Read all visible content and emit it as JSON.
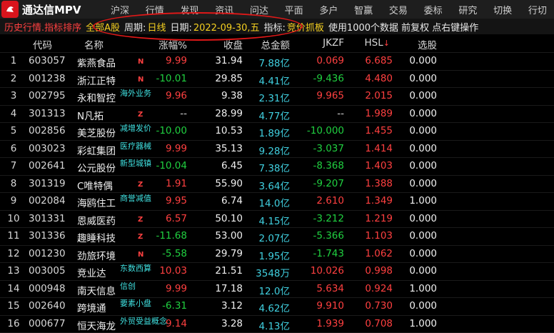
{
  "app": {
    "title": "通达信MPV"
  },
  "menu": [
    "沪深",
    "行情",
    "发现",
    "资讯",
    "问达",
    "平面",
    "多户",
    "智赢",
    "交易",
    "委标",
    "研究",
    "切换",
    "行切"
  ],
  "filter": {
    "history": "历史行情.指标排序",
    "market": "全部A股",
    "period_label": "周期:",
    "period_value": "日线",
    "date_label": "日期:",
    "date_value": "2022-09-30,五",
    "indicator_label": "指标:",
    "indicator_value": "竞价抓板",
    "note": "使用1000个数据 前复权 点右键操作"
  },
  "columns": [
    "代码",
    "名称",
    "涨幅%",
    "收盘",
    "总金额",
    "JKZF",
    "HSL",
    "选股"
  ],
  "colors": {
    "up": "#ff4040",
    "down": "#20d040",
    "accent": "#40d0e0",
    "tag": "#40e0e0"
  },
  "rows": [
    {
      "idx": "1",
      "code": "603057",
      "name": "紫燕食品",
      "mark": "N",
      "tag": "",
      "chg": "9.99",
      "close": "31.94",
      "amt": "7.88亿",
      "jk": "0.069",
      "hsl": "6.685",
      "sel": "0.000",
      "dir": "up",
      "jdir": "up"
    },
    {
      "idx": "2",
      "code": "001238",
      "name": "浙江正特",
      "mark": "N",
      "tag": "",
      "chg": "-10.01",
      "close": "29.85",
      "amt": "4.41亿",
      "jk": "-9.436",
      "hsl": "4.480",
      "sel": "0.000",
      "dir": "dn",
      "jdir": "dn"
    },
    {
      "idx": "3",
      "code": "002795",
      "name": "永和智控",
      "mark": "",
      "tag": "海外业务",
      "chg": "9.96",
      "close": "9.38",
      "amt": "2.31亿",
      "jk": "9.965",
      "hsl": "2.015",
      "sel": "0.000",
      "dir": "up",
      "jdir": "up"
    },
    {
      "idx": "4",
      "code": "301313",
      "name": "N凡拓",
      "mark": "Z",
      "tag": "",
      "chg": "--",
      "close": "28.99",
      "amt": "4.77亿",
      "jk": "--",
      "hsl": "1.989",
      "sel": "0.000",
      "dir": "flat",
      "jdir": "flat"
    },
    {
      "idx": "5",
      "code": "002856",
      "name": "美芝股份",
      "mark": "",
      "tag": "减增发价",
      "chg": "-10.00",
      "close": "10.53",
      "amt": "1.89亿",
      "jk": "-10.000",
      "hsl": "1.455",
      "sel": "0.000",
      "dir": "dn",
      "jdir": "dn"
    },
    {
      "idx": "6",
      "code": "003023",
      "name": "彩虹集团",
      "mark": "",
      "tag": "医疗器械",
      "chg": "9.99",
      "close": "35.13",
      "amt": "9.28亿",
      "jk": "-3.037",
      "hsl": "1.414",
      "sel": "0.000",
      "dir": "up",
      "jdir": "dn"
    },
    {
      "idx": "7",
      "code": "002641",
      "name": "公元股份",
      "mark": "",
      "tag": "新型城镇",
      "chg": "-10.04",
      "close": "6.45",
      "amt": "7.38亿",
      "jk": "-8.368",
      "hsl": "1.403",
      "sel": "0.000",
      "dir": "dn",
      "jdir": "dn"
    },
    {
      "idx": "8",
      "code": "301319",
      "name": "C唯特偶",
      "mark": "Z",
      "tag": "",
      "chg": "1.91",
      "close": "55.90",
      "amt": "3.64亿",
      "jk": "-9.207",
      "hsl": "1.388",
      "sel": "0.000",
      "dir": "up",
      "jdir": "dn"
    },
    {
      "idx": "9",
      "code": "002084",
      "name": "海鸥住工",
      "mark": "",
      "tag": "商誉减值",
      "chg": "9.95",
      "close": "6.74",
      "amt": "14.0亿",
      "jk": "2.610",
      "hsl": "1.349",
      "sel": "1.000",
      "dir": "up",
      "jdir": "up"
    },
    {
      "idx": "10",
      "code": "301331",
      "name": "恩威医药",
      "mark": "Z",
      "tag": "",
      "chg": "6.57",
      "close": "50.10",
      "amt": "4.15亿",
      "jk": "-3.212",
      "hsl": "1.219",
      "sel": "0.000",
      "dir": "up",
      "jdir": "dn"
    },
    {
      "idx": "11",
      "code": "301336",
      "name": "趣睡科技",
      "mark": "Z",
      "tag": "",
      "chg": "-11.68",
      "close": "53.00",
      "amt": "2.07亿",
      "jk": "-5.366",
      "hsl": "1.103",
      "sel": "0.000",
      "dir": "dn",
      "jdir": "dn"
    },
    {
      "idx": "12",
      "code": "001230",
      "name": "劲旅环境",
      "mark": "N",
      "tag": "",
      "chg": "-5.58",
      "close": "29.79",
      "amt": "1.95亿",
      "jk": "-1.743",
      "hsl": "1.062",
      "sel": "0.000",
      "dir": "dn",
      "jdir": "dn"
    },
    {
      "idx": "13",
      "code": "003005",
      "name": "竞业达",
      "mark": "",
      "tag": "东数西算",
      "chg": "10.03",
      "close": "21.51",
      "amt": "3548万",
      "jk": "10.026",
      "hsl": "0.998",
      "sel": "0.000",
      "dir": "up",
      "jdir": "up"
    },
    {
      "idx": "14",
      "code": "000948",
      "name": "南天信息",
      "mark": "",
      "tag": "信创",
      "chg": "9.99",
      "close": "17.18",
      "amt": "12.0亿",
      "jk": "5.634",
      "hsl": "0.924",
      "sel": "1.000",
      "dir": "up",
      "jdir": "up"
    },
    {
      "idx": "15",
      "code": "002640",
      "name": "跨境通",
      "mark": "",
      "tag": "要素小盘",
      "chg": "-6.31",
      "close": "3.12",
      "amt": "4.62亿",
      "jk": "9.910",
      "hsl": "0.730",
      "sel": "0.000",
      "dir": "dn",
      "jdir": "up"
    },
    {
      "idx": "16",
      "code": "000677",
      "name": "恒天海龙",
      "mark": "",
      "tag": "外贸受益概念",
      "chg": "9.14",
      "close": "3.28",
      "amt": "4.13亿",
      "jk": "1.939",
      "hsl": "0.708",
      "sel": "1.000",
      "dir": "up",
      "jdir": "up"
    }
  ]
}
